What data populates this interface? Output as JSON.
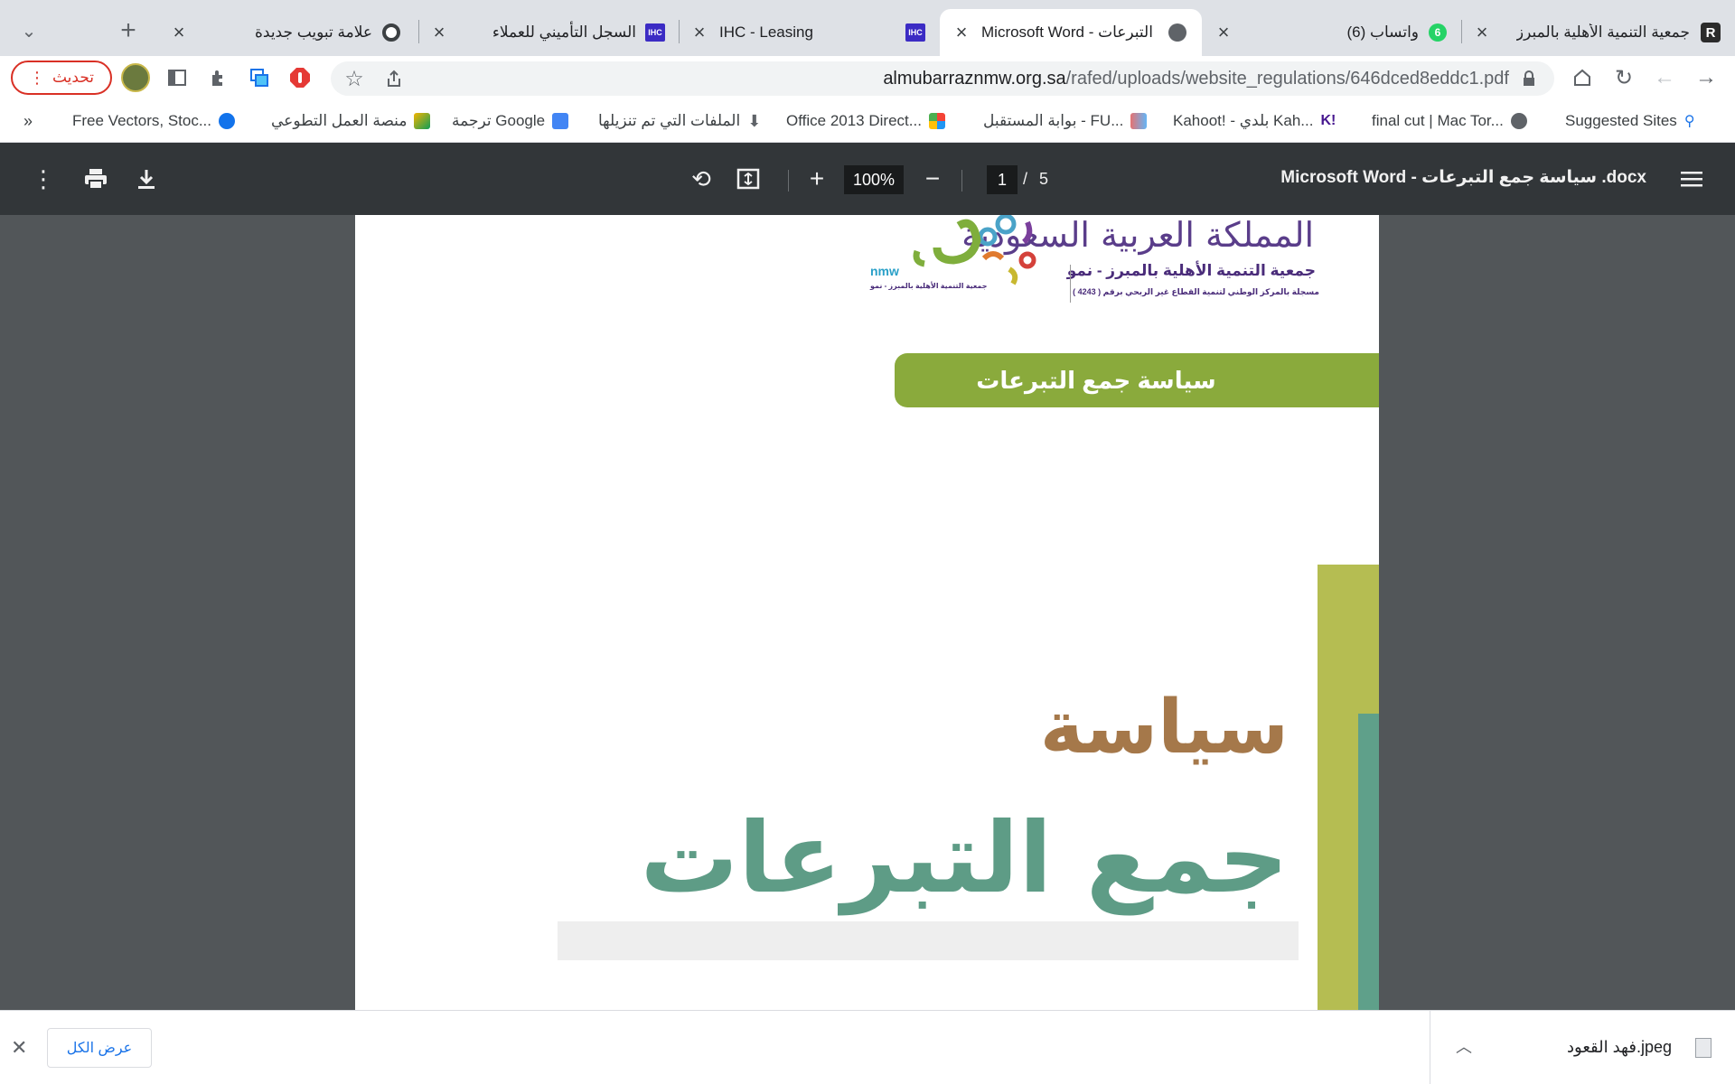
{
  "browser": {
    "tabs": [
      {
        "title": "جمعية التنمية الأهلية بالمبرز",
        "icon": "r-icon",
        "active": false
      },
      {
        "title": "(6) واتساب",
        "icon": "whatsapp-icon",
        "badge": "6",
        "active": false
      },
      {
        "title": "Microsoft Word - التبرعات",
        "icon": "globe-icon",
        "active": true
      },
      {
        "title": "IHC - Leasing",
        "icon": "ihc-icon",
        "active": false
      },
      {
        "title": "السجل التأميني للعملاء",
        "icon": "ihc-icon",
        "active": false
      },
      {
        "title": "علامة تبويب جديدة",
        "icon": "chrome-icon",
        "active": false
      }
    ],
    "ihc_icon_text": "IHC",
    "new_tab_glyph": "+",
    "tab_list_glyph": "⌄",
    "url_domain": "almubarraznmw.org.sa",
    "url_path": "/rafed/uploads/website_regulations/646dced8eddc1.pdf",
    "update_label": "تحديث",
    "bookmarks": [
      {
        "label": "Suggested Sites",
        "icon": "search-icon"
      },
      {
        "label": "final cut | Mac Tor...",
        "icon": "globe-icon"
      },
      {
        "label": "Kahoot! - بلدي Kah...",
        "icon": "kahoot-icon"
      },
      {
        "label": "بوابة المستقبل - FU...",
        "icon": "portal-icon"
      },
      {
        "label": "Office 2013 Direct...",
        "icon": "joomla-icon"
      },
      {
        "label": "الملفات التي تم تنزيلها",
        "icon": "download-icon"
      },
      {
        "label": "ترجمة Google",
        "icon": "translate-icon"
      },
      {
        "label": "منصة العمل التطوعي",
        "icon": "volunteer-icon"
      },
      {
        "label": "Free Vectors, Stoc...",
        "icon": "freepik-icon"
      }
    ],
    "bookmarks_overflow": "»"
  },
  "pdf_viewer": {
    "title": "Microsoft Word - سياسة جمع التبرعات .docx",
    "current_page": "1",
    "page_separator": "/",
    "total_pages": "5",
    "zoom": "100%"
  },
  "document": {
    "header_country": "المملكة العربية السعودية",
    "header_org": "جمعية التنمية الأهلية بالمبرز - نمو",
    "header_registration": "مسجلة بالمركز الوطني لتنمية القطاع غير الربحي برقم ( 4243 )",
    "logo_latin": "nmw",
    "logo_sub": "جمعية التنمية الأهلية بالمبرز - نمو",
    "banner_text": "سياسة جمع التبرعات",
    "title_line_1": "سياسة",
    "title_line_2": "جمع التبرعات"
  },
  "download_shelf": {
    "file_name": "فهد القعود.jpeg",
    "show_all_label": "عرض الكل"
  },
  "colors": {
    "banner_green": "#8aaa3c",
    "title_brown": "#a5784a",
    "title_teal": "#5e9c86",
    "stripe_olive": "#b5bd52",
    "logo_purple": "#5a3d8a"
  }
}
